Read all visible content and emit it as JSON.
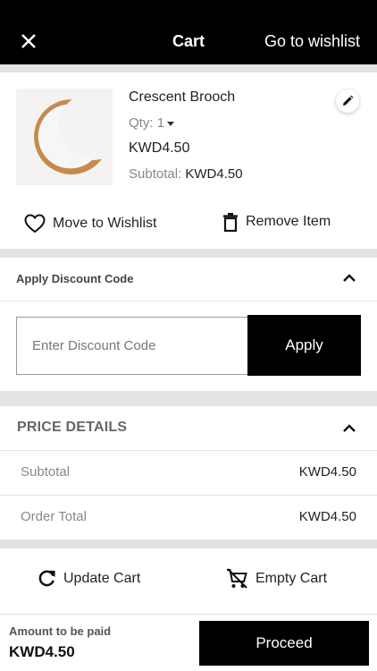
{
  "header": {
    "close_icon": "close-icon",
    "title": "Cart",
    "wishlist_link": "Go to wishlist"
  },
  "cart_item": {
    "name": "Crescent Brooch",
    "qty_label": "Qty:",
    "qty_value": "1",
    "price": "KWD4.50",
    "subtotal_label": "Subtotal:",
    "subtotal_value": "KWD4.50",
    "edit_icon": "pencil-icon",
    "move_to_wishlist": "Move to Wishlist",
    "remove_item": "Remove Item"
  },
  "discount": {
    "title": "Apply Discount Code",
    "placeholder": "Enter Discount Code",
    "apply_label": "Apply"
  },
  "price_details": {
    "title": "PRICE DETAILS",
    "rows": [
      {
        "label": "Subtotal",
        "value": "KWD4.50"
      },
      {
        "label": "Order Total",
        "value": "KWD4.50"
      }
    ]
  },
  "cart_actions": {
    "update": "Update Cart",
    "empty": "Empty Cart"
  },
  "footer": {
    "amount_label": "Amount to be paid",
    "amount_value": "KWD4.50",
    "proceed_label": "Proceed"
  },
  "colors": {
    "header_bg": "#000000",
    "button_bg": "#000000",
    "separator": "#e3e3e3"
  }
}
